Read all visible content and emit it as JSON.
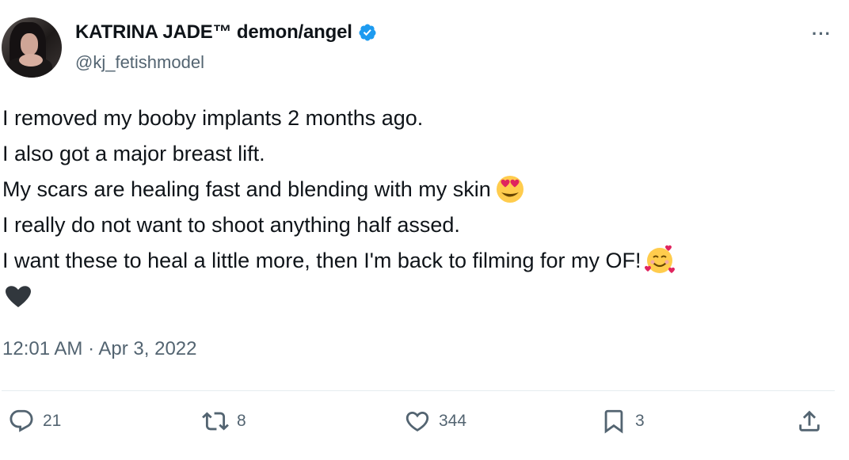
{
  "author": {
    "display_name": "KATRINA JADE™ demon/angel",
    "handle": "@kj_fetishmodel",
    "verified": true,
    "verified_color": "#1d9bf0"
  },
  "menu": {
    "more_label": "···"
  },
  "tweet": {
    "lines": [
      "I removed my booby implants 2 months ago.",
      "I also got a major breast lift.",
      "My scars are healing fast and blending with my skin",
      "I really do not want to shoot anything half assed.",
      "I want these to heal a little more, then I'm back to filming for my OF!"
    ],
    "emojis": [
      "heart-eyes-emoji",
      "smiling-face-with-hearts-emoji",
      "black-heart-emoji"
    ],
    "timestamp": "12:01 AM · Apr 3, 2022"
  },
  "actions": {
    "reply_count": "21",
    "retweet_count": "8",
    "like_count": "344",
    "bookmark_count": "3"
  },
  "colors": {
    "text": "#0f1419",
    "secondary": "#536471",
    "divider": "#e6ecf0"
  }
}
